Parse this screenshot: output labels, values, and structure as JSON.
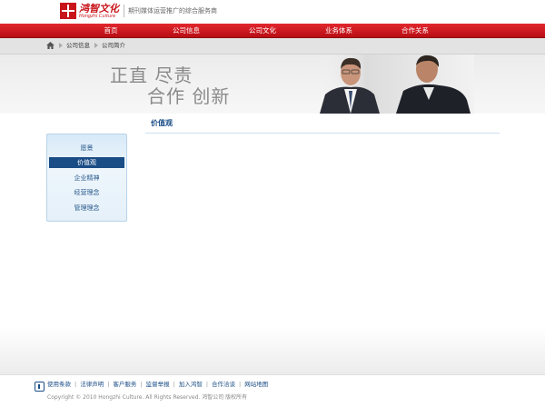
{
  "header": {
    "logo_cn": "鸿智文化",
    "logo_en": "Hongzhi Culture",
    "slogan": "期刊媒体运营推广的综合服务商"
  },
  "nav": {
    "items": [
      "首页",
      "公司信息",
      "公司文化",
      "业务体系",
      "合作关系"
    ]
  },
  "breadcrumb": {
    "items": [
      "公司信息",
      "公司简介"
    ]
  },
  "banner": {
    "line1": "正直 尽责",
    "line2": "合作 创新"
  },
  "sidebar": {
    "items": [
      "愿景",
      "价值观",
      "企业精神",
      "经营理念",
      "管理理念"
    ],
    "active_index": 1
  },
  "content": {
    "title": "价值观"
  },
  "footer": {
    "links": [
      "使用条款",
      "法律声明",
      "客户服务",
      "监督举报",
      "加入鸿智",
      "合作洽谈",
      "网站地图"
    ],
    "copyright": "Copyright © 2010 Hongzhi Culture. All Rights Reserved.  鸿智公司  版权所有"
  },
  "colors": {
    "brand_red": "#c8141b",
    "nav_red": "#d41a21",
    "accent_blue": "#1a4d86",
    "sidebar_bg": "#e5f0f9"
  }
}
